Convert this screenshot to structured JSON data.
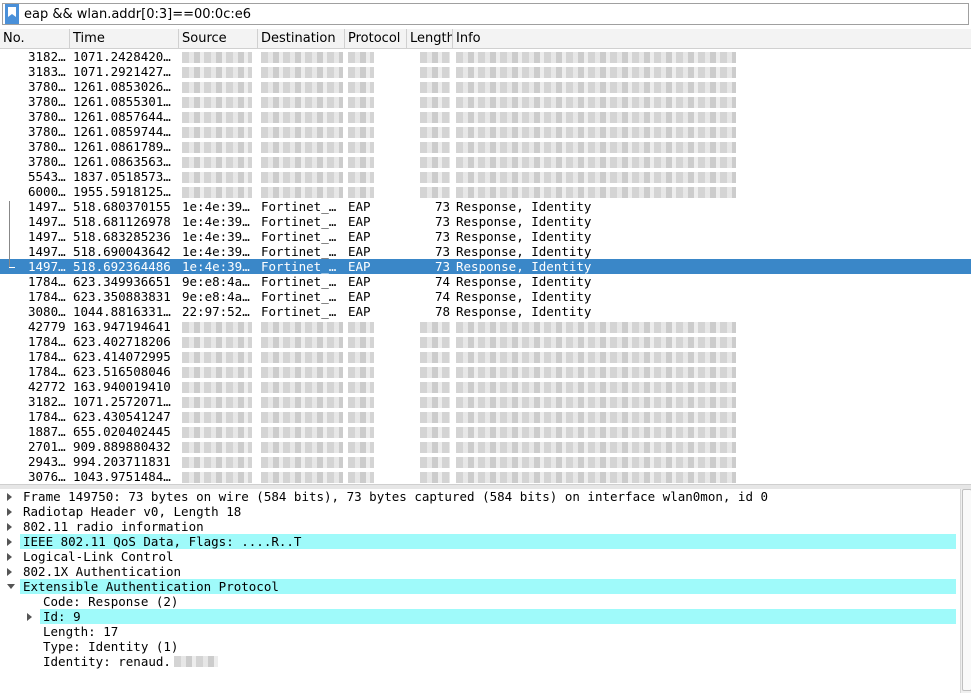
{
  "filter": {
    "value": "eap && wlan.addr[0:3]==00:0c:e6"
  },
  "columns": [
    "No.",
    "Time",
    "Source",
    "Destination",
    "Protocol",
    "Length",
    "Info"
  ],
  "packets": [
    {
      "no": "3182…",
      "time": "1071.2428420…",
      "src": "",
      "dst": "",
      "proto": "",
      "len": "",
      "info": "",
      "redacted": true
    },
    {
      "no": "3183…",
      "time": "1071.2921427…",
      "src": "",
      "dst": "",
      "proto": "",
      "len": "",
      "info": "",
      "redacted": true
    },
    {
      "no": "3780…",
      "time": "1261.0853026…",
      "src": "",
      "dst": "",
      "proto": "",
      "len": "",
      "info": "",
      "redacted": true
    },
    {
      "no": "3780…",
      "time": "1261.0855301…",
      "src": "",
      "dst": "",
      "proto": "",
      "len": "",
      "info": "",
      "redacted": true
    },
    {
      "no": "3780…",
      "time": "1261.0857644…",
      "src": "",
      "dst": "",
      "proto": "",
      "len": "",
      "info": "",
      "redacted": true
    },
    {
      "no": "3780…",
      "time": "1261.0859744…",
      "src": "",
      "dst": "",
      "proto": "",
      "len": "",
      "info": "",
      "redacted": true
    },
    {
      "no": "3780…",
      "time": "1261.0861789…",
      "src": "",
      "dst": "",
      "proto": "",
      "len": "",
      "info": "",
      "redacted": true
    },
    {
      "no": "3780…",
      "time": "1261.0863563…",
      "src": "",
      "dst": "",
      "proto": "",
      "len": "",
      "info": "",
      "redacted": true
    },
    {
      "no": "5543…",
      "time": "1837.0518573…",
      "src": "",
      "dst": "",
      "proto": "",
      "len": "",
      "info": "",
      "redacted": true
    },
    {
      "no": "6000…",
      "time": "1955.5918125…",
      "src": "",
      "dst": "",
      "proto": "",
      "len": "",
      "info": "",
      "redacted": true
    },
    {
      "no": "1497…",
      "time": "518.680370155",
      "src": "1e:4e:39…",
      "dst": "Fortinet_…",
      "proto": "EAP",
      "len": "73",
      "info": "Response, Identity"
    },
    {
      "no": "1497…",
      "time": "518.681126978",
      "src": "1e:4e:39…",
      "dst": "Fortinet_…",
      "proto": "EAP",
      "len": "73",
      "info": "Response, Identity"
    },
    {
      "no": "1497…",
      "time": "518.683285236",
      "src": "1e:4e:39…",
      "dst": "Fortinet_…",
      "proto": "EAP",
      "len": "73",
      "info": "Response, Identity"
    },
    {
      "no": "1497…",
      "time": "518.690043642",
      "src": "1e:4e:39…",
      "dst": "Fortinet_…",
      "proto": "EAP",
      "len": "73",
      "info": "Response, Identity"
    },
    {
      "no": "1497…",
      "time": "518.692364486",
      "src": "1e:4e:39…",
      "dst": "Fortinet_…",
      "proto": "EAP",
      "len": "73",
      "info": "Response, Identity",
      "selected": true
    },
    {
      "no": "1784…",
      "time": "623.349936651",
      "src": "9e:e8:4a…",
      "dst": "Fortinet_…",
      "proto": "EAP",
      "len": "74",
      "info": "Response, Identity"
    },
    {
      "no": "1784…",
      "time": "623.350883831",
      "src": "9e:e8:4a…",
      "dst": "Fortinet_…",
      "proto": "EAP",
      "len": "74",
      "info": "Response, Identity"
    },
    {
      "no": "3080…",
      "time": "1044.8816331…",
      "src": "22:97:52…",
      "dst": "Fortinet_…",
      "proto": "EAP",
      "len": "78",
      "info": "Response, Identity"
    },
    {
      "no": "42779",
      "time": "163.947194641",
      "src": "",
      "dst": "",
      "proto": "",
      "len": "",
      "info": "",
      "redacted": true
    },
    {
      "no": "1784…",
      "time": "623.402718206",
      "src": "",
      "dst": "",
      "proto": "",
      "len": "",
      "info": "",
      "redacted": true
    },
    {
      "no": "1784…",
      "time": "623.414072995",
      "src": "",
      "dst": "",
      "proto": "",
      "len": "",
      "info": "",
      "redacted": true
    },
    {
      "no": "1784…",
      "time": "623.516508046",
      "src": "",
      "dst": "",
      "proto": "",
      "len": "",
      "info": "",
      "redacted": true
    },
    {
      "no": "42772",
      "time": "163.940019410",
      "src": "",
      "dst": "",
      "proto": "",
      "len": "",
      "info": "",
      "redacted": true
    },
    {
      "no": "3182…",
      "time": "1071.2572071…",
      "src": "",
      "dst": "",
      "proto": "",
      "len": "",
      "info": "",
      "redacted": true
    },
    {
      "no": "1784…",
      "time": "623.430541247",
      "src": "",
      "dst": "",
      "proto": "",
      "len": "",
      "info": "",
      "redacted": true
    },
    {
      "no": "1887…",
      "time": "655.020402445",
      "src": "",
      "dst": "",
      "proto": "",
      "len": "",
      "info": "",
      "redacted": true
    },
    {
      "no": "2701…",
      "time": "909.889880432",
      "src": "",
      "dst": "",
      "proto": "",
      "len": "",
      "info": "",
      "redacted": true
    },
    {
      "no": "2943…",
      "time": "994.203711831",
      "src": "",
      "dst": "",
      "proto": "",
      "len": "",
      "info": "",
      "redacted": true
    },
    {
      "no": "3076…",
      "time": "1043.9751484…",
      "src": "",
      "dst": "",
      "proto": "",
      "len": "",
      "info": "",
      "redacted": true
    }
  ],
  "details": [
    {
      "text": "Frame 149750: 73 bytes on wire (584 bits), 73 bytes captured (584 bits) on interface wlan0mon, id 0",
      "indent": 0,
      "arrow": "right"
    },
    {
      "text": "Radiotap Header v0, Length 18",
      "indent": 0,
      "arrow": "right"
    },
    {
      "text": "802.11 radio information",
      "indent": 0,
      "arrow": "right"
    },
    {
      "text": "IEEE 802.11 QoS Data, Flags: ....R..T",
      "indent": 0,
      "arrow": "right",
      "highlight": true
    },
    {
      "text": "Logical-Link Control",
      "indent": 0,
      "arrow": "right"
    },
    {
      "text": "802.1X Authentication",
      "indent": 0,
      "arrow": "right"
    },
    {
      "text": "Extensible Authentication Protocol",
      "indent": 0,
      "arrow": "down",
      "highlight": true
    },
    {
      "text": "Code: Response (2)",
      "indent": 1,
      "arrow": ""
    },
    {
      "text": "Id: 9",
      "indent": 1,
      "arrow": "right",
      "highlight": true
    },
    {
      "text": "Length: 17",
      "indent": 1,
      "arrow": ""
    },
    {
      "text": "Type: Identity (1)",
      "indent": 1,
      "arrow": ""
    },
    {
      "text": "Identity: renaud.",
      "indent": 1,
      "arrow": "",
      "redacted_tail": true
    }
  ],
  "colors": {
    "selection": "#3a87c8",
    "detail_highlight": "#9ffafa",
    "bookmark": "#4a90d9"
  }
}
